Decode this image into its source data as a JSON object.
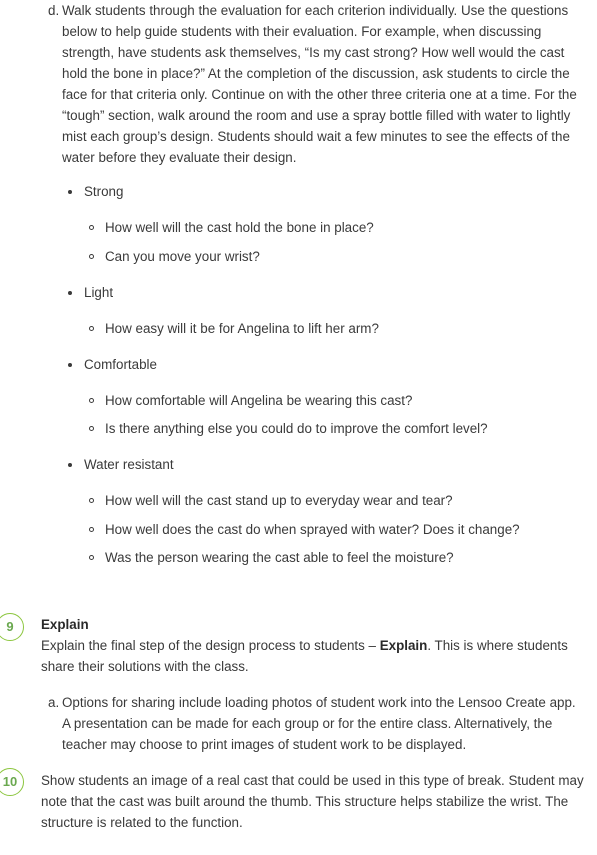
{
  "item_d": {
    "marker": "d.",
    "text": "Walk students through the evaluation for each criterion individually. Use the questions below to help guide students with their evaluation. For example, when discussing strength, have students ask themselves, “Is my cast strong? How well would the cast hold the bone in place?” At the completion of the discussion, ask students to circle the face for that criteria only. Continue on with the other three criteria one at a time. For the “tough” section, walk around the room and use a spray bottle filled with water to lightly mist each group’s design. Students should wait a few minutes to see the effects of the water before they evaluate their design."
  },
  "criteria": [
    {
      "label": "Strong",
      "questions": [
        "How well will the cast hold the bone in place?",
        "Can you move your wrist?"
      ]
    },
    {
      "label": "Light",
      "questions": [
        "How easy will it be for Angelina to lift her arm?"
      ]
    },
    {
      "label": "Comfortable",
      "questions": [
        "How comfortable will Angelina be wearing this cast?",
        "Is there anything else you could do to improve the comfort level?"
      ]
    },
    {
      "label": "Water resistant",
      "questions": [
        "How well will the cast stand up to everyday wear and tear?",
        "How well does the cast do when sprayed with water? Does it change?",
        "Was the person wearing the cast able to feel the moisture?"
      ]
    }
  ],
  "step9": {
    "number": "9",
    "heading": "Explain",
    "text_before": "Explain the final step of the design process to students – ",
    "text_bold": "Explain",
    "text_after": ". This is where students share their solutions with the class."
  },
  "item_a": {
    "marker": "a.",
    "text": "Options for sharing include loading photos of student work into the Lensoo Create app. A presentation can be made for each group or for the entire class. Alternatively, the teacher may choose to print images of student work to be displayed."
  },
  "step10": {
    "number": "10",
    "text": "Show students an image of a real cast that could be used in this type of break. Student may note that the cast was built around the thumb. This structure helps stabilize the wrist. The structure is related to the function."
  },
  "colors": {
    "text": "#3a3a3a",
    "step_accent": "#8cc63f",
    "step_number": "#6aa84f"
  }
}
